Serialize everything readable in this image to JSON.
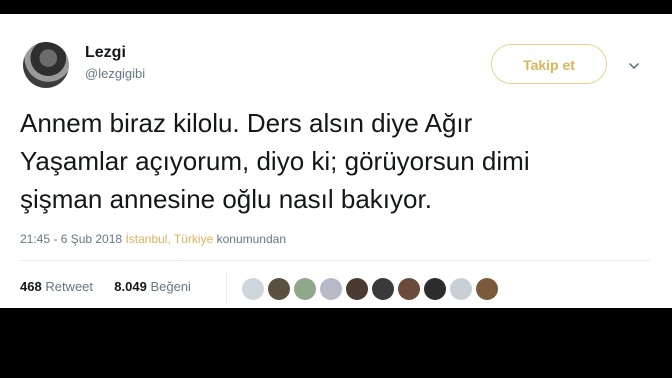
{
  "user": {
    "display_name": "Lezgi",
    "handle": "@lezgigibi"
  },
  "follow_button": {
    "label": "Takip et"
  },
  "tweet": {
    "lines": [
      "Annem biraz kilolu. Ders alsın diye Ağır",
      "Yaşamlar açıyorum, diyo ki; görüyorsun dimi",
      "şişman annesine oğlu nasıl bakıyor."
    ],
    "time": "21:45 - 6 Şub 2018",
    "location": "İstanbul, Türkiye",
    "location_suffix": "konumundan"
  },
  "stats": {
    "retweet_count": "468",
    "retweet_label": "Retweet",
    "like_count": "8.049",
    "like_label": "Beğeni"
  },
  "likers": {
    "colors": [
      "#cfd6db",
      "#5a5040",
      "#8fa88a",
      "#b8b8c8",
      "#4a3a30",
      "#3a3a3a",
      "#6a4a3a",
      "#2c2c2c",
      "#c8d0d6",
      "#7a5a3a"
    ]
  },
  "icons": {
    "menu": "chevron-down-icon"
  },
  "colors": {
    "background": "#000000",
    "card": "#ffffff",
    "follow_accent": "#d8b45a",
    "location": "#e0b15b",
    "secondary_text": "#657786"
  }
}
